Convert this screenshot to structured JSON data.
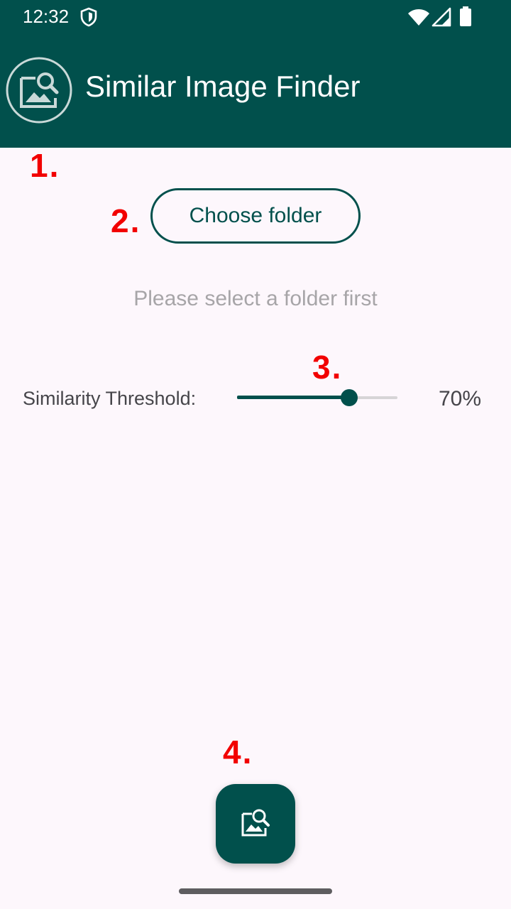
{
  "status_bar": {
    "time": "12:32",
    "icons": [
      "shield-icon",
      "wifi-icon",
      "cell-signal-icon",
      "battery-icon"
    ]
  },
  "app_bar": {
    "title": "Similar Image Finder",
    "logo_icon": "image-search-icon",
    "color": "#01504c"
  },
  "annotations": {
    "marker1": "1.",
    "marker2": "2.",
    "marker3": "3.",
    "marker4": "4.",
    "color": "#f20000"
  },
  "main": {
    "choose_folder_label": "Choose folder",
    "hint": "Please select a folder first",
    "threshold_label": "Similarity Threshold:",
    "threshold_value_text": "70%",
    "threshold_fraction": 0.7
  },
  "fab": {
    "icon": "image-search-icon"
  }
}
